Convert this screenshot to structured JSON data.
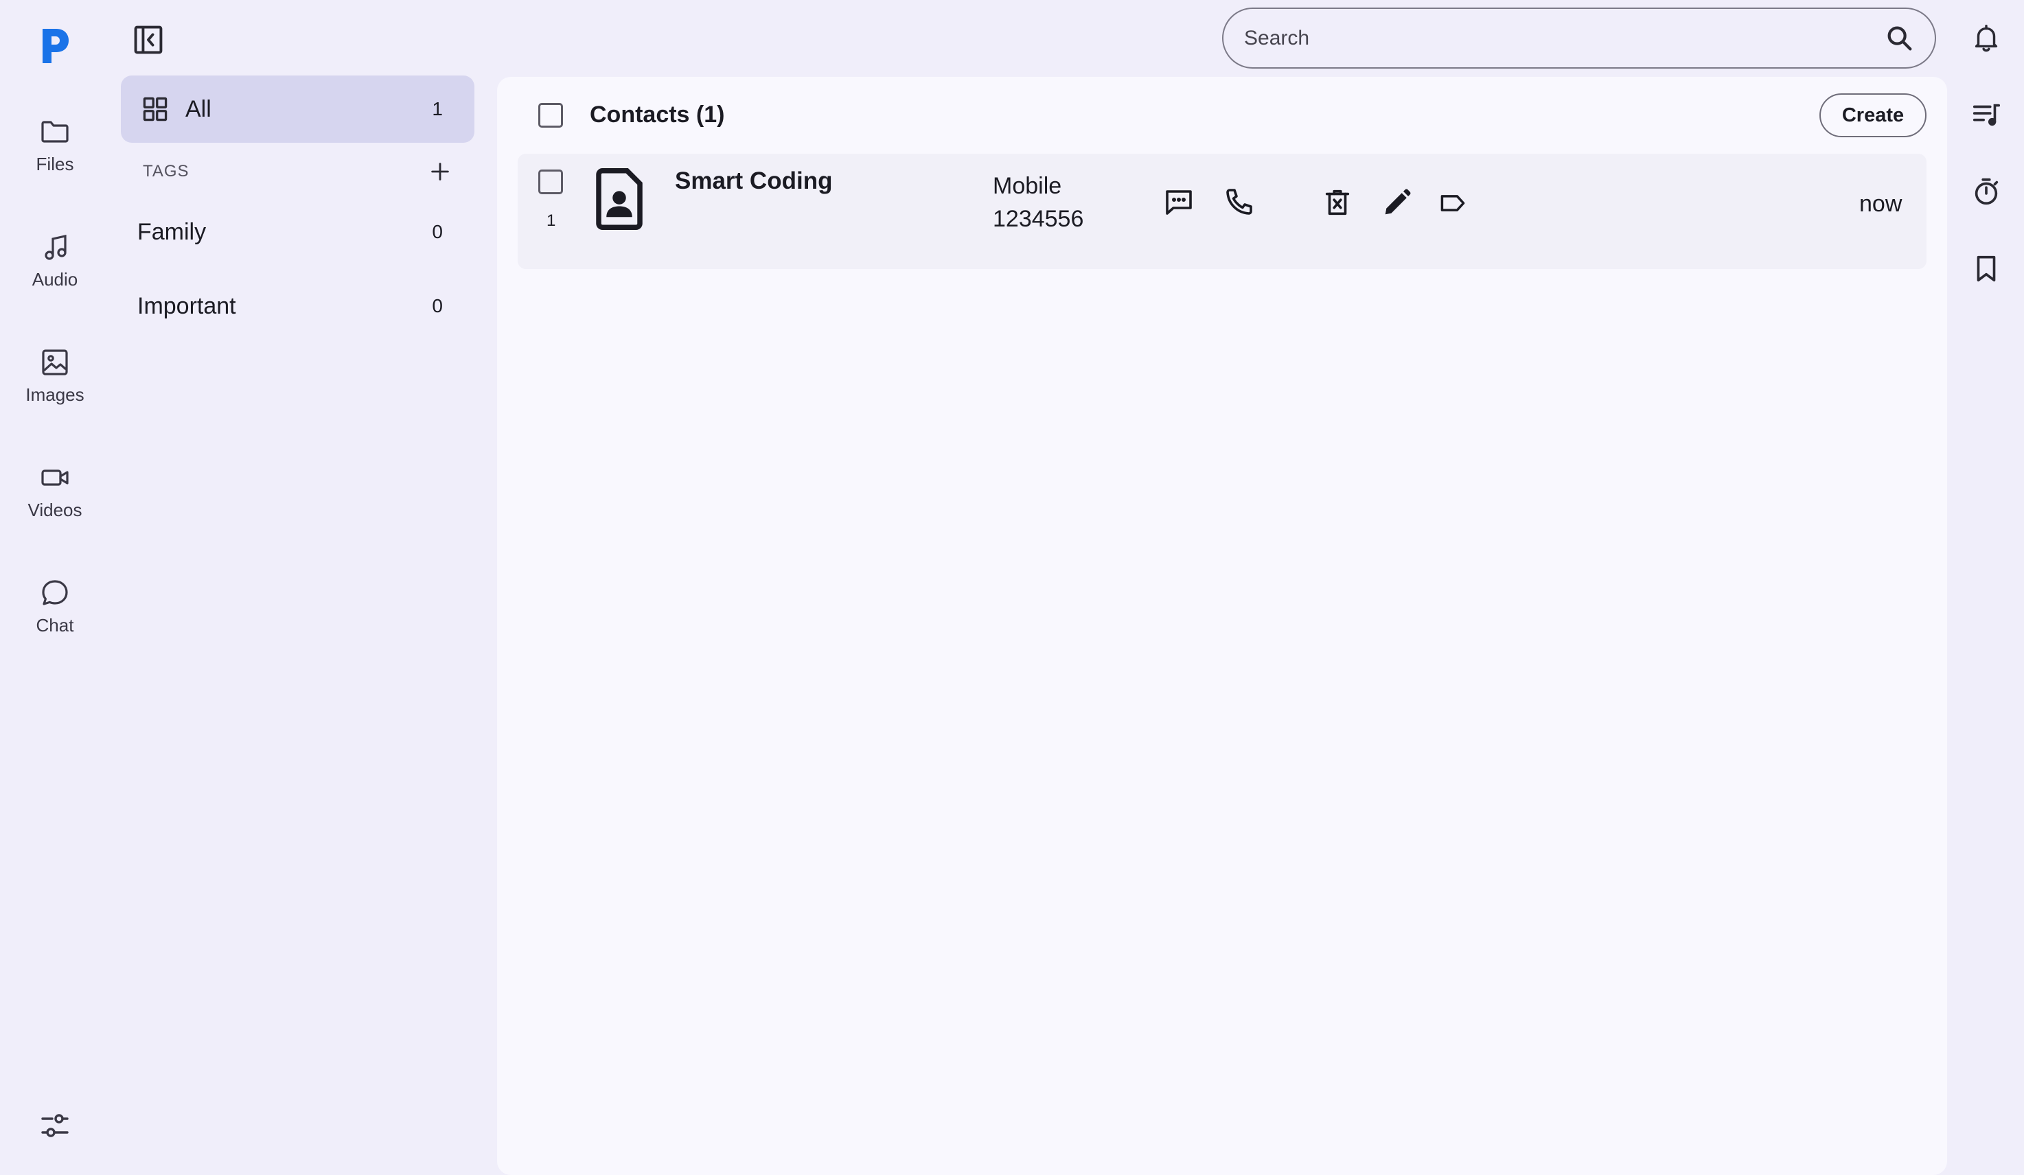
{
  "rail": {
    "items": [
      {
        "label": "Files",
        "icon": "folder-icon"
      },
      {
        "label": "Audio",
        "icon": "music-note-icon"
      },
      {
        "label": "Images",
        "icon": "image-icon"
      },
      {
        "label": "Videos",
        "icon": "video-camera-icon"
      },
      {
        "label": "Chat",
        "icon": "chat-bubble-icon"
      }
    ]
  },
  "sidebar": {
    "all": {
      "label": "All",
      "count": "1"
    },
    "tags_heading": "TAGS",
    "tags": [
      {
        "label": "Family",
        "count": "0"
      },
      {
        "label": "Important",
        "count": "0"
      }
    ]
  },
  "search": {
    "placeholder": "Search"
  },
  "main": {
    "title": "Contacts (1)",
    "create_label": "Create",
    "contacts": [
      {
        "index": "1",
        "name": "Smart Coding",
        "phone_type": "Mobile",
        "phone_number": "1234556",
        "time": "now"
      }
    ]
  },
  "colors": {
    "background": "#f0eefa",
    "panel": "#f9f8fe",
    "selected": "#d6d5ef",
    "logo": "#1a73e8"
  }
}
